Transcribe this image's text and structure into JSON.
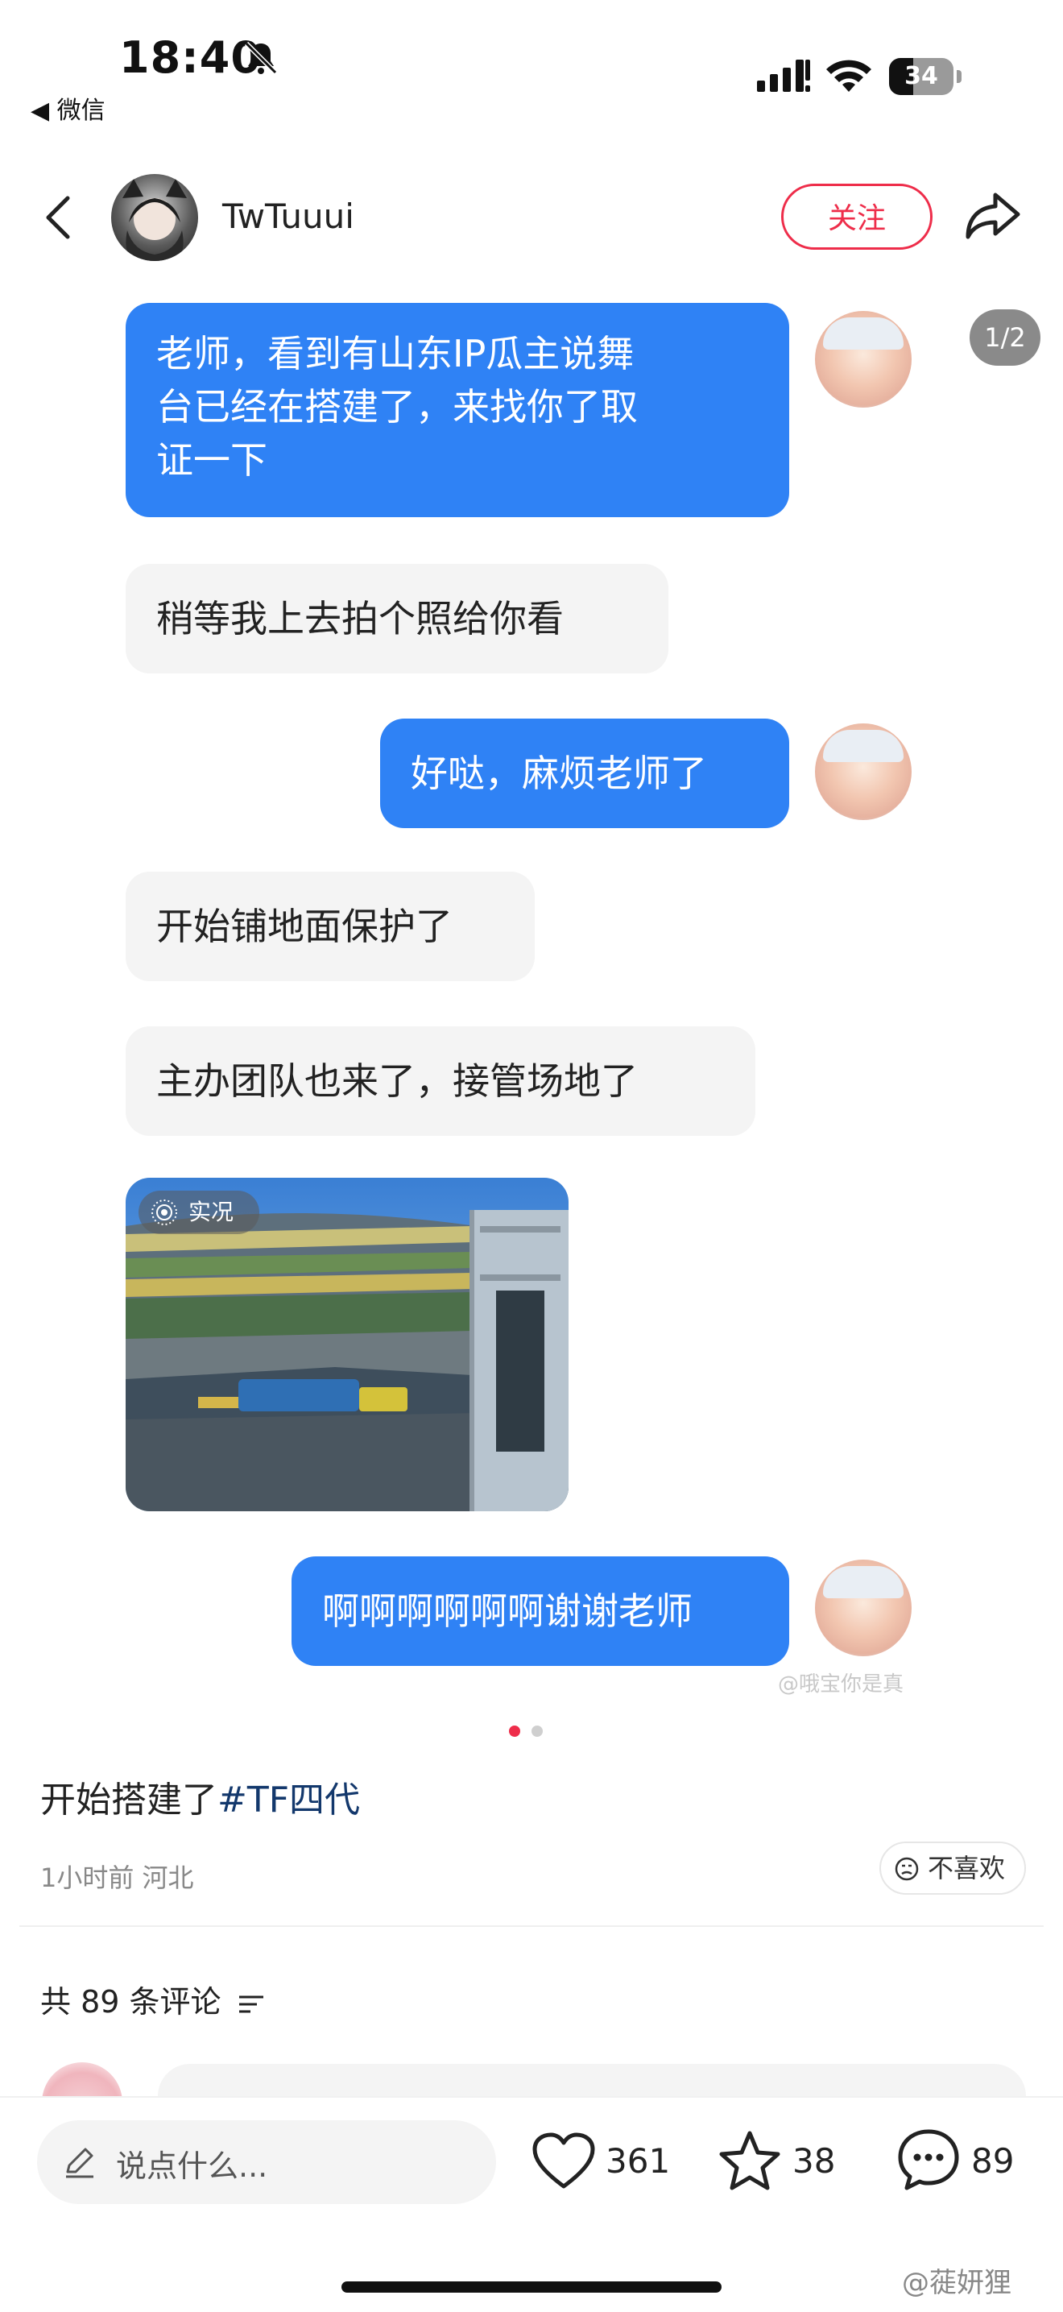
{
  "status_bar": {
    "time": "18:40",
    "back_app": "◀ 微信",
    "battery": "34"
  },
  "header": {
    "username": "TwTuuui",
    "follow_label": "关注",
    "pager": "1/2"
  },
  "chat": {
    "msg1": [
      "老师，看到有山东IP瓜主说舞",
      "台已经在搭建了，来找你了取",
      "证一下"
    ],
    "msg2": "稍等我上去拍个照给你看",
    "msg3": "好哒，麻烦老师了",
    "msg4": "开始铺地面保护了",
    "msg5": "主办团队也来了，接管场地了",
    "photo_badge": "实况",
    "msg6": "啊啊啊啊啊啊谢谢老师",
    "watermark": "@哦宝你是真"
  },
  "post": {
    "caption_text": "开始搭建了",
    "caption_tag": "#TF四代",
    "meta": "1小时前 河北",
    "dislike_label": "不喜欢",
    "comment_count": "共 89 条评论"
  },
  "bottom": {
    "say_placeholder": "说点什么...",
    "likes": "361",
    "stars": "38",
    "comments": "89",
    "watermark": "@蓰妍狸"
  },
  "colors": {
    "accent_red": "#ee2d4a",
    "bubble_blue": "#2f82f5",
    "tag_blue": "#13386c"
  }
}
